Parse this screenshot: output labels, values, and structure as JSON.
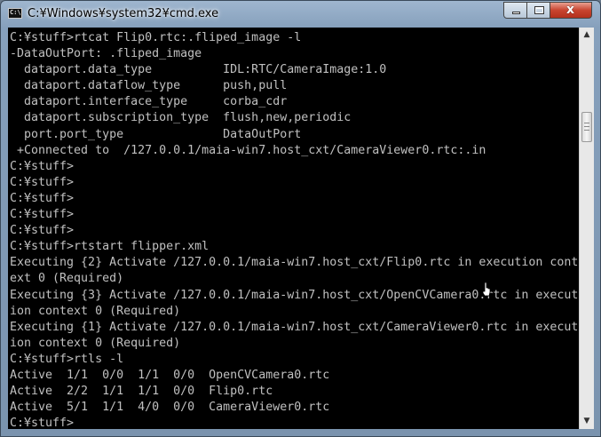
{
  "window": {
    "title": "C:¥Windows¥system32¥cmd.exe",
    "icon_text": "C:\\"
  },
  "colors": {
    "console_bg": "#000000",
    "console_text": "#c0c0c0",
    "close_button": "#c8442f"
  },
  "controls": {
    "minimize_icon": "minimize-icon",
    "maximize_icon": "maximize-icon",
    "close_icon": "close-icon",
    "close_glyph": "x"
  },
  "scrollbar": {
    "up_glyph": "▲",
    "down_glyph": "▼"
  },
  "console": {
    "lines": [
      "C:¥stuff>rtcat Flip0.rtc:.fliped_image -l",
      "-DataOutPort: .fliped_image",
      "  dataport.data_type          IDL:RTC/CameraImage:1.0",
      "  dataport.dataflow_type      push,pull",
      "  dataport.interface_type     corba_cdr",
      "  dataport.subscription_type  flush,new,periodic",
      "  port.port_type              DataOutPort",
      " +Connected to  /127.0.0.1/maia-win7.host_cxt/CameraViewer0.rtc:.in",
      "C:¥stuff>",
      "C:¥stuff>",
      "C:¥stuff>",
      "C:¥stuff>",
      "C:¥stuff>",
      "C:¥stuff>rtstart flipper.xml",
      "Executing {2} Activate /127.0.0.1/maia-win7.host_cxt/Flip0.rtc in execution cont",
      "ext 0 (Required)",
      "Executing {3} Activate /127.0.0.1/maia-win7.host_cxt/OpenCVCamera0.rtc in execut",
      "ion context 0 (Required)",
      "Executing {1} Activate /127.0.0.1/maia-win7.host_cxt/CameraViewer0.rtc in execut",
      "ion context 0 (Required)",
      "C:¥stuff>rtls -l",
      "Active  1/1  0/0  1/1  0/0  OpenCVCamera0.rtc",
      "Active  2/2  1/1  1/1  0/0  Flip0.rtc",
      "Active  5/1  1/1  4/0  0/0  CameraViewer0.rtc",
      "C:¥stuff>"
    ]
  }
}
